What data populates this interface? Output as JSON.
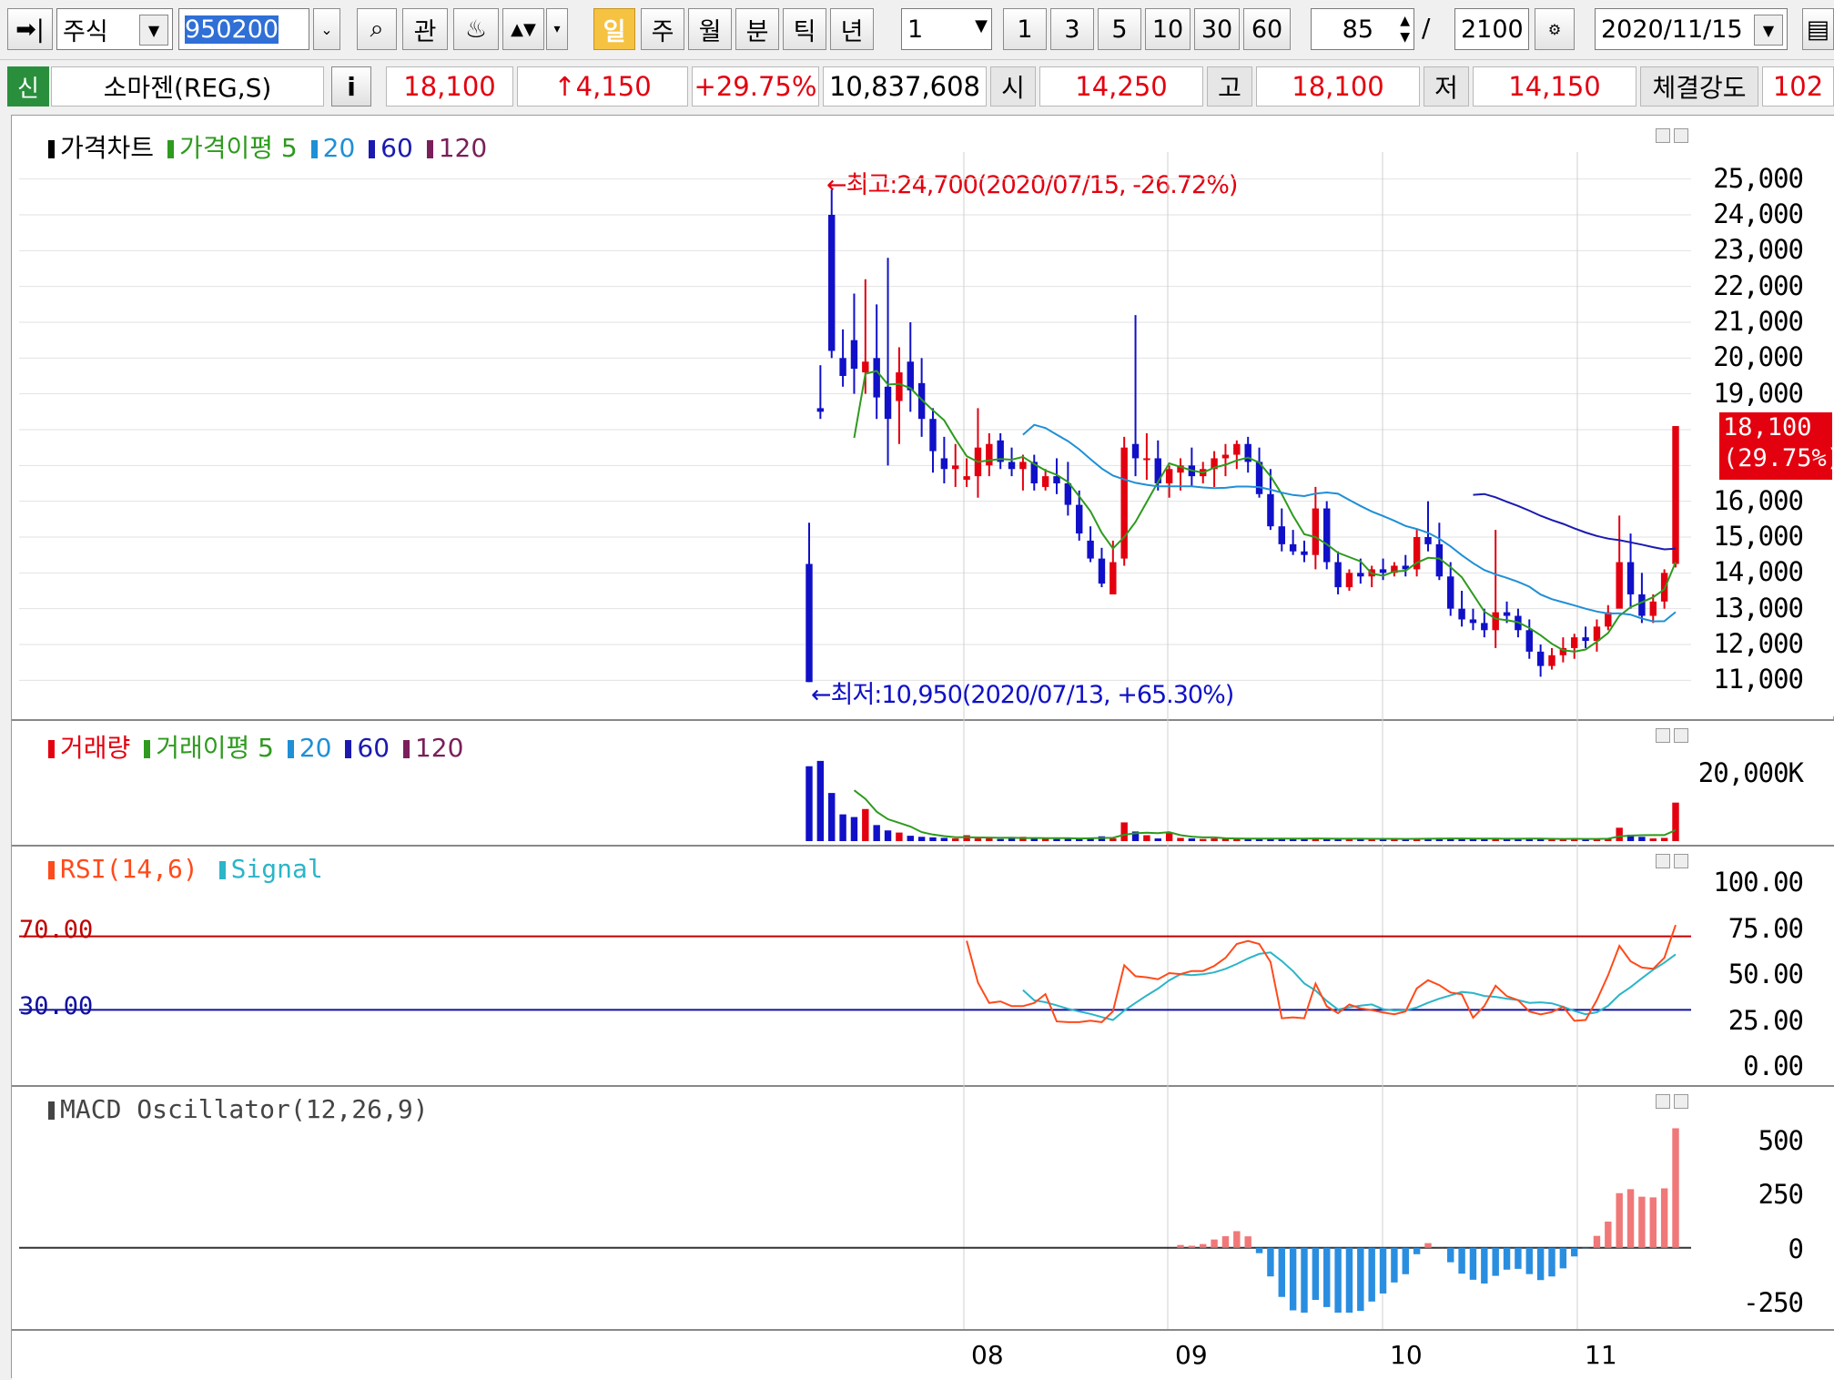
{
  "toolbar": {
    "market": "주식",
    "code": "950200",
    "btn_gwan": "관",
    "periods": [
      "일",
      "주",
      "월",
      "분",
      "틱",
      "년"
    ],
    "interval_value": "1",
    "interval_buttons": [
      "1",
      "3",
      "5",
      "10",
      "30",
      "60"
    ],
    "count_value": "85",
    "count_total": "2100",
    "date": "2020/11/15"
  },
  "quote": {
    "badge": "신",
    "name": "소마젠(REG,S)",
    "info_btn": "i",
    "price": "18,100",
    "change": "↑4,150",
    "change_pct": "+29.75%",
    "volume": "10,837,608",
    "open_label": "시",
    "open": "14,250",
    "high_label": "고",
    "high": "18,100",
    "low_label": "저",
    "low": "14,150",
    "strength_label": "체결강도",
    "strength": "102"
  },
  "colors": {
    "up": "#e3000f",
    "down": "#1010c8",
    "ma5": "#2e9a1e",
    "ma20": "#1f8fd6",
    "ma60": "#1a1ab0",
    "ma120": "#7a1f5a",
    "rsi": "#ff4a1a",
    "signal": "#2bb5c8"
  },
  "price_panel": {
    "legend_title": "가격차트",
    "legend_ma": "가격이평 5",
    "ma20": "20",
    "ma60": "60",
    "ma120": "120",
    "y_labels": [
      "25,000",
      "24,000",
      "23,000",
      "22,000",
      "21,000",
      "20,000",
      "19,000",
      "16,000",
      "15,000",
      "14,000",
      "13,000",
      "12,000",
      "11,000"
    ],
    "current_price": "18,100",
    "current_pct": "(29.75%)",
    "high_note": "←최고:24,700(2020/07/15, -26.72%)",
    "low_note": "←최저:10,950(2020/07/13, +65.30%)"
  },
  "volume_panel": {
    "legend_title": "거래량",
    "legend_ma": "거래이평 5",
    "ma20": "20",
    "ma60": "60",
    "ma120": "120",
    "y_label": "20,000K"
  },
  "rsi_panel": {
    "legend_rsi": "RSI(14,6)",
    "legend_signal": "Signal",
    "level_high": "70.00",
    "level_low": "30.00",
    "y_labels": [
      "100.00",
      "75.00",
      "50.00",
      "25.00",
      "0.00"
    ]
  },
  "macd_panel": {
    "legend": "MACD Oscillator(12,26,9)",
    "y_labels": [
      "500",
      "250",
      "0",
      "-250"
    ]
  },
  "x_axis": [
    "08",
    "09",
    "10",
    "11"
  ],
  "chart_data": {
    "type": "candlestick",
    "title": "가격차트",
    "ylim": [
      10500,
      25500
    ],
    "candles": [
      [
        14250,
        10950,
        15400,
        10950
      ],
      [
        18600,
        19800,
        18300,
        18500
      ],
      [
        24000,
        24700,
        20000,
        20200
      ],
      [
        20000,
        20800,
        19200,
        19500
      ],
      [
        20500,
        21800,
        19000,
        19700
      ],
      [
        19600,
        22200,
        19000,
        19900
      ],
      [
        20000,
        21500,
        18300,
        18900
      ],
      [
        19200,
        22800,
        17000,
        18300
      ],
      [
        18800,
        20300,
        17600,
        19600
      ],
      [
        19900,
        21000,
        18500,
        19100
      ],
      [
        19300,
        20000,
        17800,
        18300
      ],
      [
        18300,
        18600,
        16800,
        17400
      ],
      [
        17200,
        17800,
        16500,
        16900
      ],
      [
        16900,
        17600,
        16400,
        17000
      ],
      [
        16600,
        17200,
        16400,
        16700
      ],
      [
        16700,
        18600,
        16100,
        17500
      ],
      [
        17000,
        17900,
        16700,
        17600
      ],
      [
        17700,
        17900,
        16900,
        17100
      ],
      [
        17100,
        17500,
        16700,
        16900
      ],
      [
        16900,
        17300,
        16300,
        17100
      ],
      [
        17100,
        17300,
        16300,
        16500
      ],
      [
        16400,
        16900,
        16300,
        16700
      ],
      [
        16700,
        17200,
        16200,
        16500
      ],
      [
        16500,
        17100,
        15600,
        15900
      ],
      [
        15900,
        16300,
        14900,
        15100
      ],
      [
        14900,
        15300,
        14300,
        14400
      ],
      [
        14400,
        14700,
        13600,
        13700
      ],
      [
        13400,
        14900,
        13400,
        14300
      ],
      [
        14400,
        17800,
        14200,
        17500
      ],
      [
        17600,
        21200,
        16700,
        17200
      ],
      [
        17200,
        17900,
        16600,
        17200
      ],
      [
        17200,
        17700,
        16300,
        16500
      ],
      [
        16500,
        17000,
        16100,
        16900
      ],
      [
        16800,
        17200,
        16300,
        17000
      ],
      [
        17000,
        17500,
        16400,
        16700
      ],
      [
        16700,
        17100,
        16500,
        16900
      ],
      [
        16900,
        17400,
        16400,
        17200
      ],
      [
        17200,
        17600,
        16700,
        17300
      ],
      [
        17300,
        17700,
        16900,
        17600
      ],
      [
        17600,
        17800,
        16800,
        17100
      ],
      [
        17100,
        17500,
        16100,
        16200
      ],
      [
        16200,
        16900,
        15200,
        15300
      ],
      [
        15300,
        15800,
        14600,
        14800
      ],
      [
        14800,
        15200,
        14500,
        14600
      ],
      [
        14600,
        14900,
        14300,
        14500
      ],
      [
        14500,
        16400,
        14100,
        15800
      ],
      [
        15800,
        16000,
        14100,
        14300
      ],
      [
        14300,
        14600,
        13400,
        13600
      ],
      [
        13600,
        14100,
        13500,
        14000
      ],
      [
        14000,
        14400,
        13700,
        13900
      ],
      [
        13900,
        14200,
        13600,
        14100
      ],
      [
        14100,
        14400,
        13800,
        14000
      ],
      [
        14000,
        14300,
        13900,
        14200
      ],
      [
        14200,
        14500,
        13900,
        14100
      ],
      [
        14100,
        15200,
        13900,
        15000
      ],
      [
        15000,
        16000,
        14600,
        14800
      ],
      [
        14800,
        15400,
        13800,
        13900
      ],
      [
        13900,
        14300,
        12800,
        13000
      ],
      [
        13000,
        13500,
        12500,
        12700
      ],
      [
        12700,
        13000,
        12400,
        12600
      ],
      [
        12600,
        13000,
        12200,
        12400
      ],
      [
        12400,
        15200,
        11900,
        12900
      ],
      [
        12900,
        13200,
        12600,
        12800
      ],
      [
        12800,
        13000,
        12200,
        12400
      ],
      [
        12400,
        12700,
        11600,
        11800
      ],
      [
        11800,
        12000,
        11100,
        11400
      ],
      [
        11400,
        11900,
        11300,
        11700
      ],
      [
        11700,
        12200,
        11500,
        11900
      ],
      [
        11900,
        12300,
        11600,
        12200
      ],
      [
        12200,
        12500,
        11900,
        12100
      ],
      [
        12100,
        12700,
        11800,
        12500
      ],
      [
        12500,
        13100,
        12400,
        12900
      ],
      [
        13000,
        15600,
        13200,
        14300
      ],
      [
        14300,
        15100,
        13000,
        13400
      ],
      [
        13400,
        14000,
        12600,
        12800
      ],
      [
        12800,
        13400,
        12600,
        13200
      ],
      [
        13200,
        14100,
        13000,
        14000
      ],
      [
        14250,
        18100,
        14150,
        18100
      ]
    ],
    "x_tick_labels": [
      "08",
      "09",
      "10",
      "11"
    ],
    "volume_values": [
      14,
      15,
      9,
      5,
      4.5,
      6,
      3,
      2,
      1.6,
      1,
      0.8,
      0.7,
      0.6,
      0.5,
      1.1,
      0.5,
      0.6,
      0.4,
      0.6,
      0.8,
      0.5,
      0.5,
      0.4,
      0.6,
      0.5,
      0.6,
      0.9,
      0.5,
      3.5,
      1.8,
      1.1,
      0.5,
      1.5,
      0.6,
      0.5,
      0.4,
      0.5,
      0.6,
      0.5,
      0.4,
      0.4,
      0.5,
      0.6,
      0.5,
      0.4,
      0.5,
      0.4,
      0.4,
      0.5,
      0.4,
      0.4,
      0.4,
      0.4,
      0.4,
      0.5,
      0.5,
      0.6,
      0.5,
      0.4,
      0.4,
      0.4,
      0.6,
      0.4,
      0.4,
      0.5,
      0.4,
      0.4,
      0.3,
      0.5,
      0.4,
      0.4,
      0.6,
      2.5,
      1.2,
      0.8,
      0.5,
      0.6,
      7.2
    ],
    "rsi_levels": [
      70,
      30
    ],
    "macd_range": [
      -250,
      500
    ]
  }
}
